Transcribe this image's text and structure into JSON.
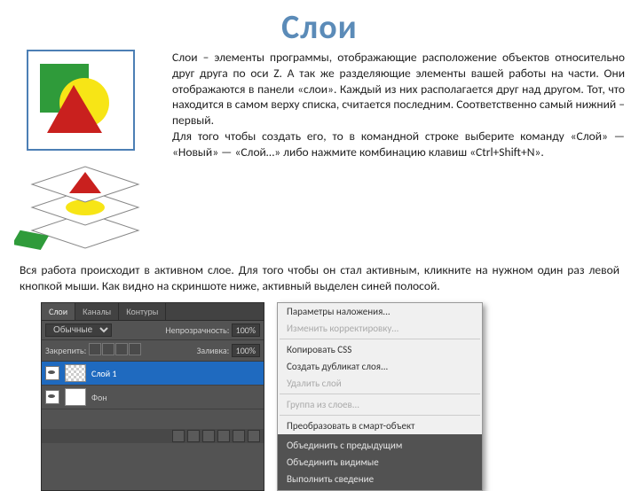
{
  "title": "Слои",
  "top_paragraph": "Слои – элементы программы, отображающие расположение объектов относительно друг друга по оси Z. А так же разделяющие элементы вашей работы на части. Они отображаются в панели «слои». Каждый из них располагается друг над другом. Тот, что находится в самом верху списка, считается последним. Соответственно самый нижний – первый.\nДля того чтобы создать его, то в командной строке выберите команду «Слой» — «Новый» — «Слой…» либо нажмите комбинацию клавиш «Ctrl+Shift+N».",
  "mid_paragraph": "Вся работа происходит в активном слое. Для того чтобы он стал активным, кликните на нужном один раз левой кнопкой мыши. Как видно на скриншоте ниже, активный выделен синей полосой.",
  "layers_panel": {
    "tabs": [
      "Слои",
      "Каналы",
      "Контуры"
    ],
    "mode_label": "Обычные",
    "opacity_label": "Непрозрачность:",
    "opacity_value": "100%",
    "lock_label": "Закрепить:",
    "fill_label": "Заливка:",
    "fill_value": "100%",
    "rows": [
      {
        "name": "Слой 1",
        "active": true
      },
      {
        "name": "Фон",
        "active": false
      }
    ]
  },
  "ctx_menu": {
    "items_top": [
      {
        "label": "Параметры наложения...",
        "disabled": false
      },
      {
        "label": "Изменить корректировку...",
        "disabled": true
      }
    ],
    "items_mid": [
      {
        "label": "Копировать CSS",
        "disabled": false
      },
      {
        "label": "Создать дубликат слоя...",
        "disabled": false
      },
      {
        "label": "Удалить слой",
        "disabled": true
      },
      {
        "label": "Группа из слоев...",
        "disabled": true
      }
    ],
    "items_mid2": [
      {
        "label": "Преобразовать в смарт-объект",
        "disabled": false
      }
    ],
    "items_bottom": [
      {
        "label": "Объединить с предыдущим",
        "dim": false
      },
      {
        "label": "Объединить видимые",
        "dim": false
      },
      {
        "label": "Выполнить сведение",
        "dim": false
      }
    ]
  }
}
